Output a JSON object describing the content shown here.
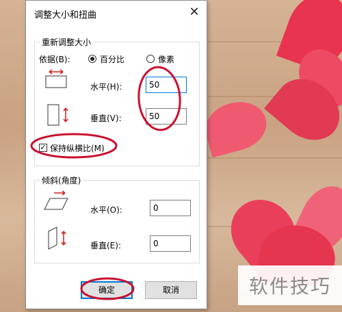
{
  "dialog": {
    "title": "调整大小和扭曲",
    "close_glyph": "✕"
  },
  "resize": {
    "group_title": "重新调整大小",
    "by_label": "依据(B):",
    "option_percent": "百分比",
    "option_pixels": "像素",
    "selected": "百分比",
    "horizontal_label": "水平(H):",
    "horizontal_value": "50",
    "vertical_label": "垂直(V):",
    "vertical_value": "50",
    "keep_ratio_label": "保持纵横比(M)",
    "keep_ratio_checked": true,
    "check_glyph": "✓"
  },
  "skew": {
    "group_title": "倾斜(角度)",
    "horizontal_label": "水平(O):",
    "horizontal_value": "0",
    "vertical_label": "垂直(E):",
    "vertical_value": "0"
  },
  "buttons": {
    "ok": "确定",
    "cancel": "取消"
  },
  "watermark": "软件技巧",
  "colors": {
    "annotation_red": "#c8102e",
    "focus_blue": "#0078d7",
    "petal_red": "#e8344f"
  }
}
